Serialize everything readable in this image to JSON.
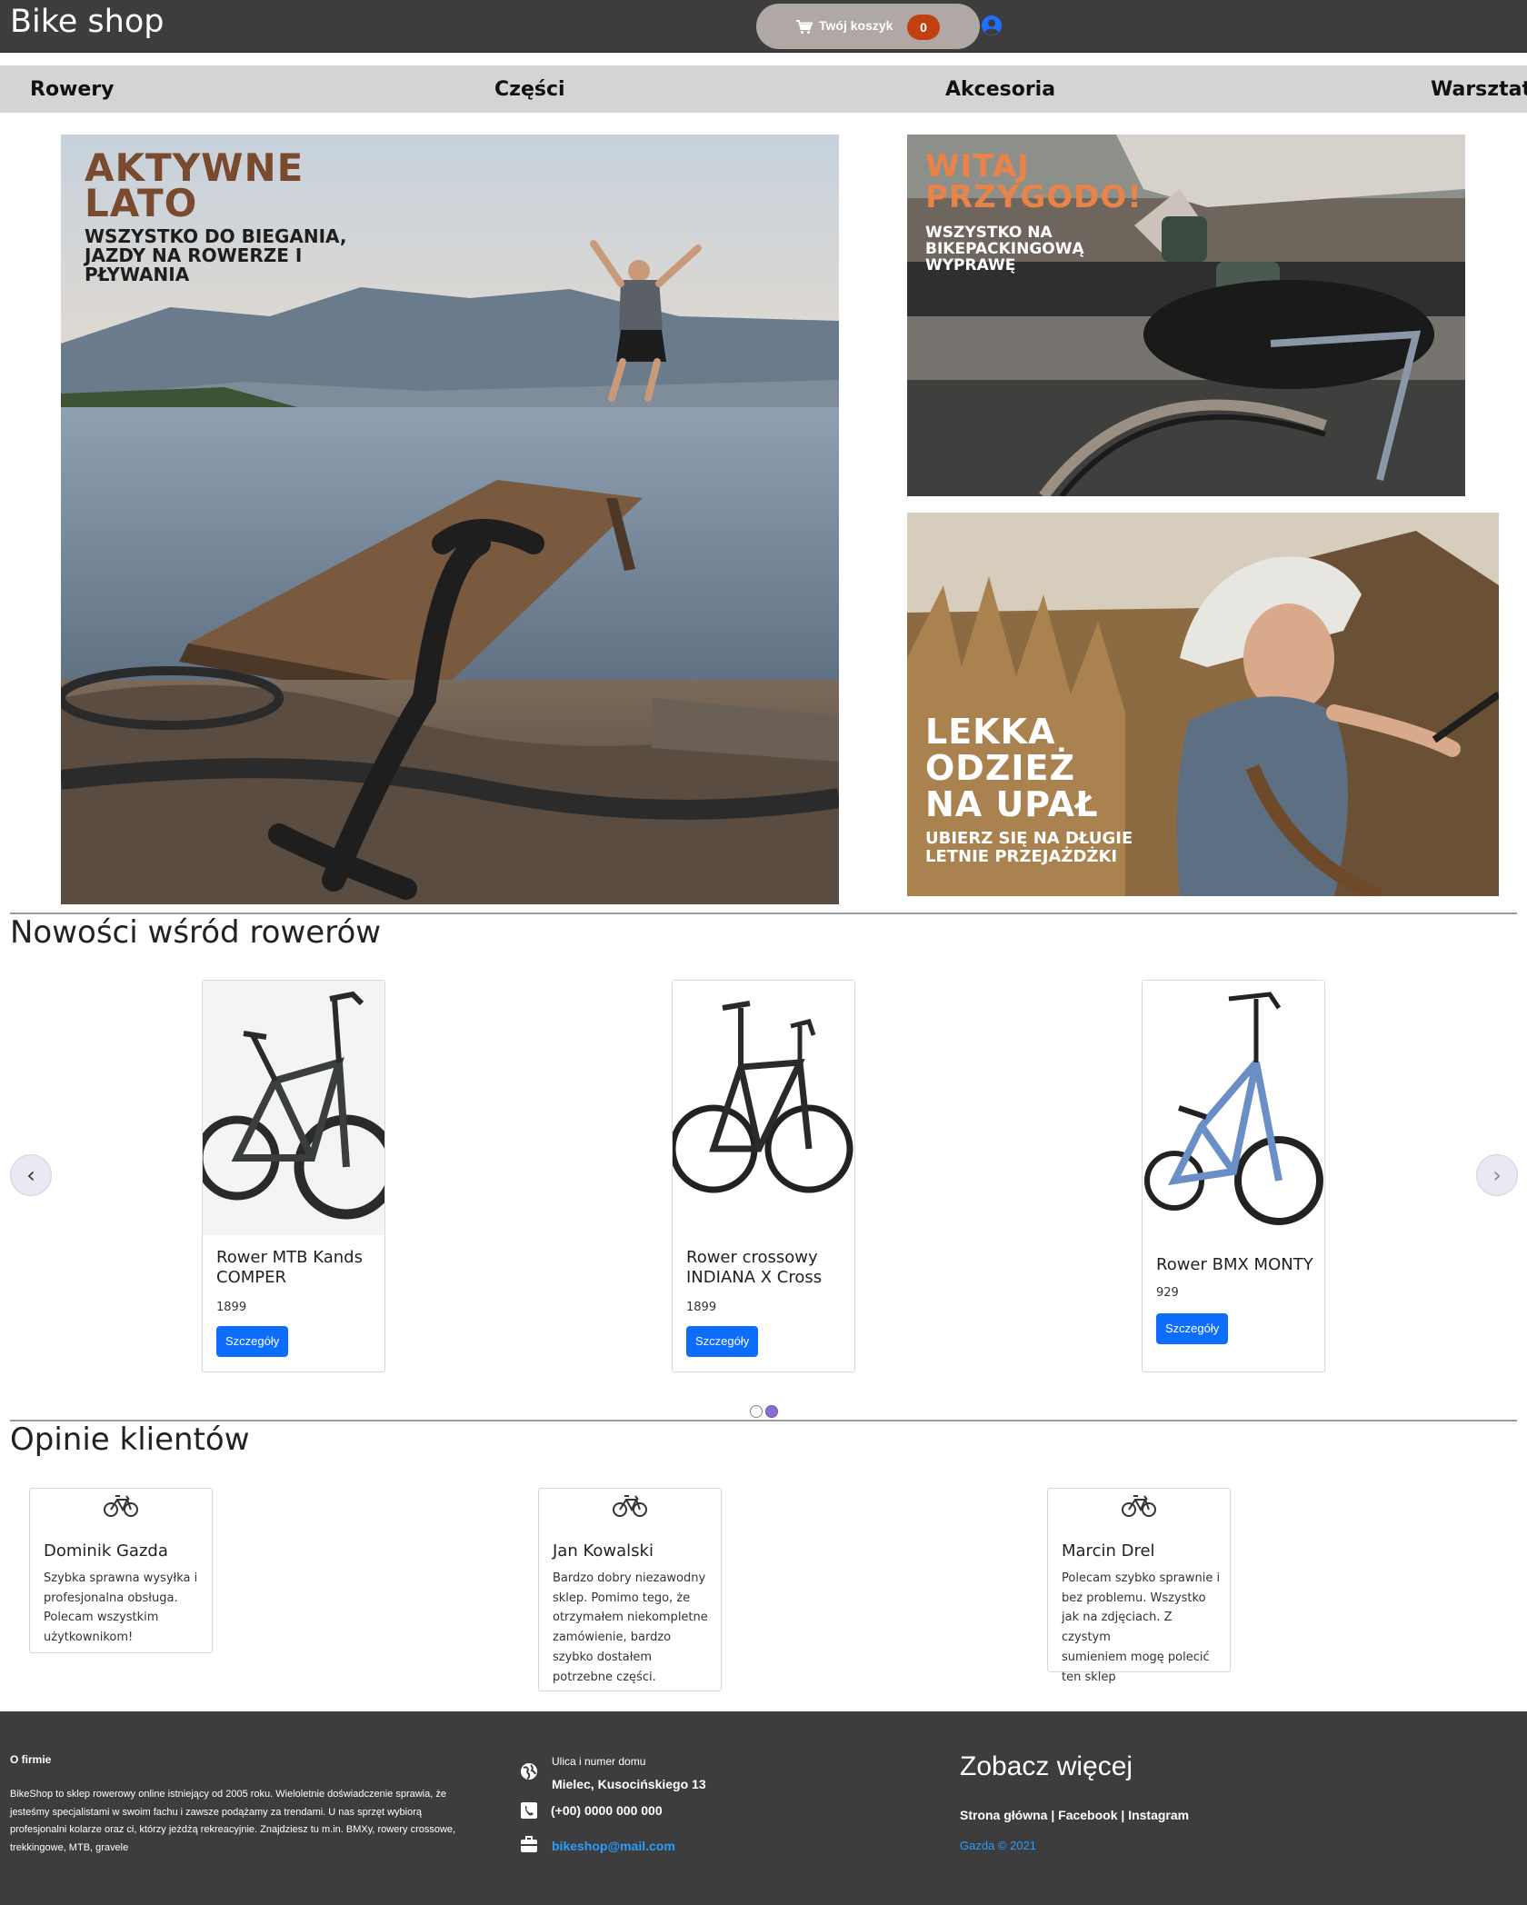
{
  "header": {
    "brand": "Bike shop",
    "cart_label": "Twój koszyk",
    "cart_count": "0"
  },
  "nav": {
    "items": [
      {
        "label": "Rowery"
      },
      {
        "label": "Części"
      },
      {
        "label": "Akcesoria"
      },
      {
        "label": "Warsztat"
      }
    ]
  },
  "banners": {
    "main": {
      "title1": "AKTYWNE",
      "title2": "LATO",
      "sub1": "WSZYSTKO DO BIEGANIA,",
      "sub2": "JAZDY NA ROWERZE I",
      "sub3": "PŁYWANIA"
    },
    "top_right": {
      "title1": "WITAJ",
      "title2": "PRZYGODO!",
      "sub1": "WSZYSTKO NA",
      "sub2": "BIKEPACKINGOWĄ",
      "sub3": "WYPRAWĘ"
    },
    "bottom_right": {
      "title1": "LEKKA",
      "title2": "ODZIEŻ",
      "title3": "NA UPAŁ",
      "sub1": "UBIERZ SIĘ NA DŁUGIE",
      "sub2": "LETNIE PRZEJAŻDŻKI"
    }
  },
  "new_bikes": {
    "title": "Nowości wśród rowerów",
    "prev": "‹",
    "next": "›",
    "products": [
      {
        "name1": "Rower MTB Kands",
        "name2": "COMPER",
        "price": "1899",
        "button": "Szczegóły"
      },
      {
        "name1": "Rower crossowy",
        "name2": "INDIANA X Cross",
        "price": "1899",
        "button": "Szczegóły"
      },
      {
        "name1": "Rower BMX MONTY",
        "price": "929",
        "button": "Szczegóły"
      }
    ],
    "active_slide": 2,
    "slide_count": 2
  },
  "reviews": {
    "title": "Opinie klientów",
    "items": [
      {
        "name": "Dominik Gazda",
        "lines": [
          "Szybka sprawna wysyłka i",
          "profesjonalna obsługa.",
          "Polecam wszystkim",
          "użytkownikom!"
        ]
      },
      {
        "name": "Jan Kowalski",
        "lines": [
          "Bardzo dobry niezawodny",
          "sklep. Pomimo tego, że",
          "otrzymałem niekompletne",
          "zamówienie, bardzo",
          "szybko dostałem",
          "potrzebne części."
        ]
      },
      {
        "name": "Marcin Drel",
        "lines": [
          "Polecam szybko sprawnie i",
          "bez problemu. Wszystko",
          "jak na zdjęciach. Z czystym",
          "sumieniem mogę polecić",
          "ten sklep"
        ]
      }
    ]
  },
  "footer": {
    "about_title": "O firmie",
    "about_lines": [
      "BikeShop to sklep rowerowy online istniejący od 2005 roku. Wieloletnie doświadczenie sprawia, że",
      "jesteśmy specjalistami w swoim fachu i zawsze podążamy za trendami. U nas sprzęt wybiorą",
      "profesjonalni kolarze oraz ci, którzy jeżdżą rekreacyjnie. Znajdziesz tu m.in. BMXy, rowery crossowe,",
      "trekkingowe, MTB, gravele"
    ],
    "address_label": "Ulica i numer domu",
    "address": "Mielec, Kusocińskiego 13",
    "phone": "(+00) 0000 000 000",
    "email": "bikeshop@mail.com",
    "more_title": "Zobacz więcej",
    "links": "Strona główna | Facebook | Instagram",
    "copyright": "Gazda © 2021"
  }
}
